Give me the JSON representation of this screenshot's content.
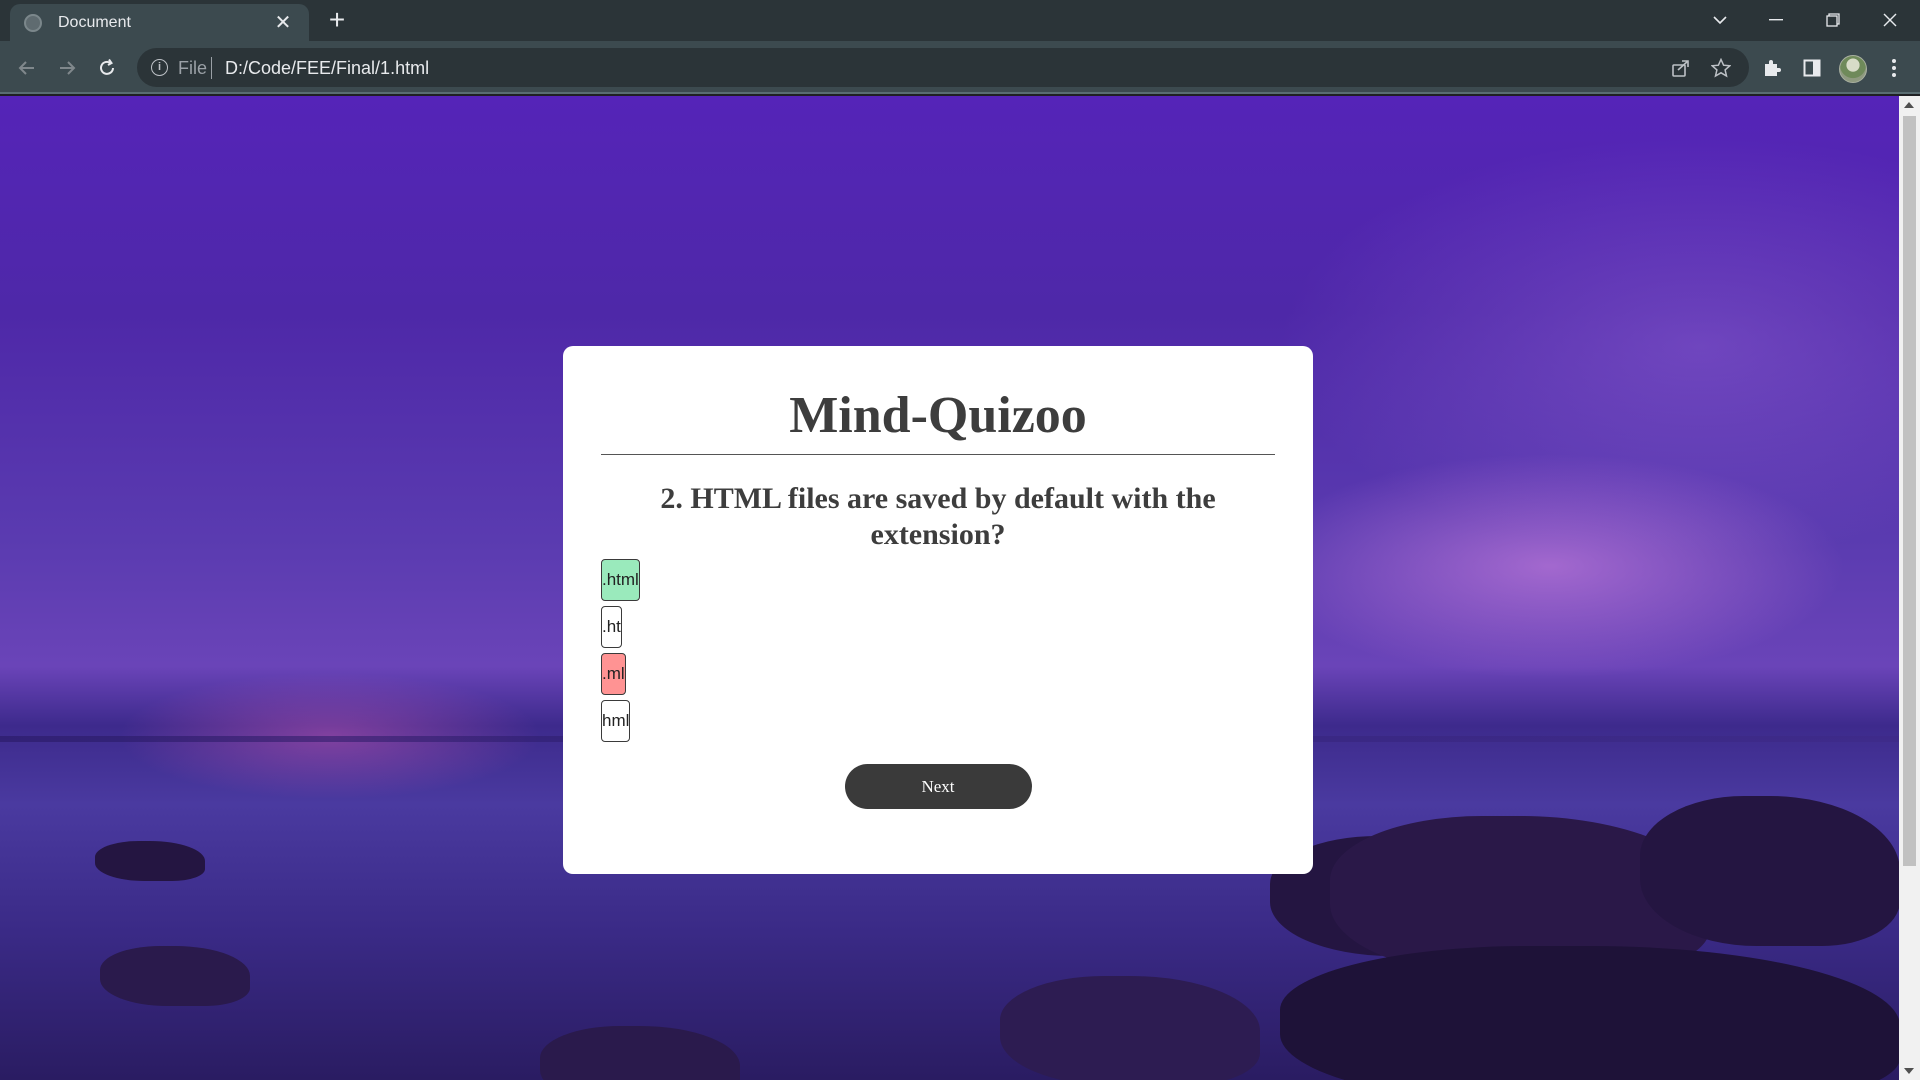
{
  "browser": {
    "tab": {
      "title": "Document"
    },
    "omnibox": {
      "scheme_label": "File",
      "url": "D:/Code/FEE/Final/1.html"
    }
  },
  "quiz": {
    "title": "Mind-Quizoo",
    "question": "2. HTML files are saved by default with the extension?",
    "answers": [
      {
        "label": ".html",
        "state": "correct"
      },
      {
        "label": ".ht",
        "state": "neutral"
      },
      {
        "label": ".ml",
        "state": "wrong"
      },
      {
        "label": "hml",
        "state": "neutral"
      }
    ],
    "next_label": "Next"
  },
  "colors": {
    "correct": "#9aeabc",
    "wrong": "#ff9393",
    "button": "#3a3a3a",
    "browser_frame": "#3c4a4f"
  }
}
